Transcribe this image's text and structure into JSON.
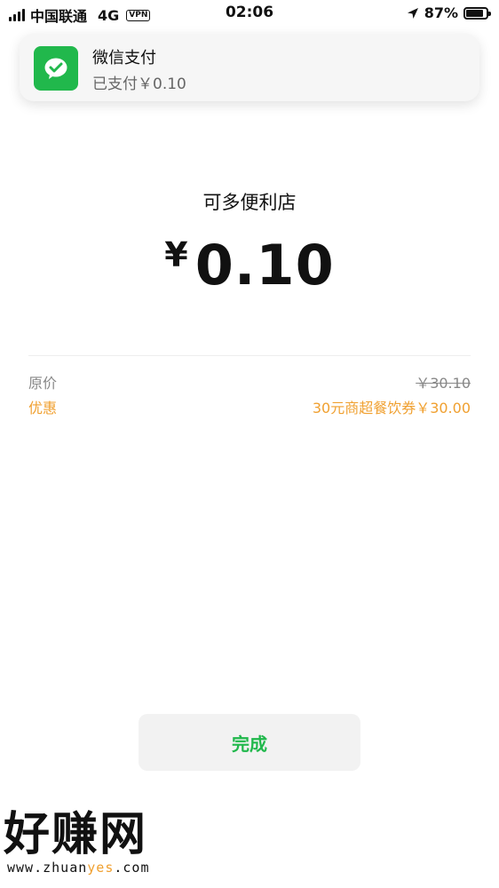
{
  "status_bar": {
    "carrier": "中国联通",
    "network": "4G",
    "vpn": "VPN",
    "time": "02:06",
    "battery": "87%",
    "battery_level": 0.87
  },
  "notification": {
    "icon": "wechat-pay-icon",
    "title": "微信支付",
    "subtitle": "已支付￥0.10"
  },
  "payment": {
    "merchant": "可多便利店",
    "currency": "¥",
    "amount": "0.10"
  },
  "details": {
    "original_label": "原价",
    "original_value": "￥30.10",
    "discount_label": "优惠",
    "discount_value": "30元商超餐饮券￥30.00"
  },
  "done_button": "完成",
  "watermark": {
    "title": "好赚网",
    "url_prefix": "www.zhuan",
    "url_highlight": "yes",
    "url_suffix": ".com"
  },
  "colors": {
    "accent_green": "#21b84c",
    "discount_orange": "#f0a030"
  }
}
